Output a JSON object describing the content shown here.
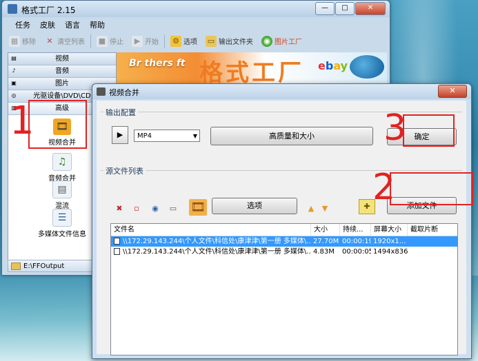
{
  "main_window": {
    "title": "格式工厂 2.15",
    "menu": [
      "任务",
      "皮肤",
      "语言",
      "帮助"
    ],
    "toolbar": {
      "remove": "移除",
      "clear_list": "清空列表",
      "stop": "停止",
      "start": "开始",
      "options": "选项",
      "output_folder": "输出文件夹",
      "picture_factory": "图片工厂"
    },
    "categories": [
      "视频",
      "音频",
      "图片",
      "光驱设备\\DVD\\CD",
      "高级"
    ],
    "advanced_tools": [
      "视频合并",
      "音频合并",
      "混流",
      "多媒体文件信息"
    ],
    "output_path": "E:\\FFOutput",
    "banner": {
      "brothersoft": "Br thers ft",
      "brand": "格式工厂",
      "ebay": [
        "e",
        "b",
        "a",
        "y"
      ]
    }
  },
  "dialog": {
    "title": "视频合并",
    "output_config_label": "输出配置",
    "format_value": "MP4",
    "quality_button": "高质量和大小",
    "ok_button": "确定",
    "source_list_label": "源文件列表",
    "options_button": "选项",
    "add_file_button": "添加文件",
    "columns": [
      "文件名",
      "大小",
      "持续...",
      "屏幕大小",
      "截取片断"
    ],
    "rows": [
      {
        "name": "\\\\172.29.143.244\\个人文件\\科信处\\康津津\\第一册 多媒体\\...",
        "size": "27.70M",
        "duration": "00:00:19",
        "screen": "1920x1...",
        "clip": ""
      },
      {
        "name": "\\\\172.29.143.244\\个人文件\\科信处\\康津津\\第一册 多媒体\\...",
        "size": "4.83M",
        "duration": "00:00:05",
        "screen": "1494x836",
        "clip": ""
      }
    ]
  },
  "annotations": {
    "mark1": "1",
    "mark2": "2",
    "mark3": "3"
  }
}
